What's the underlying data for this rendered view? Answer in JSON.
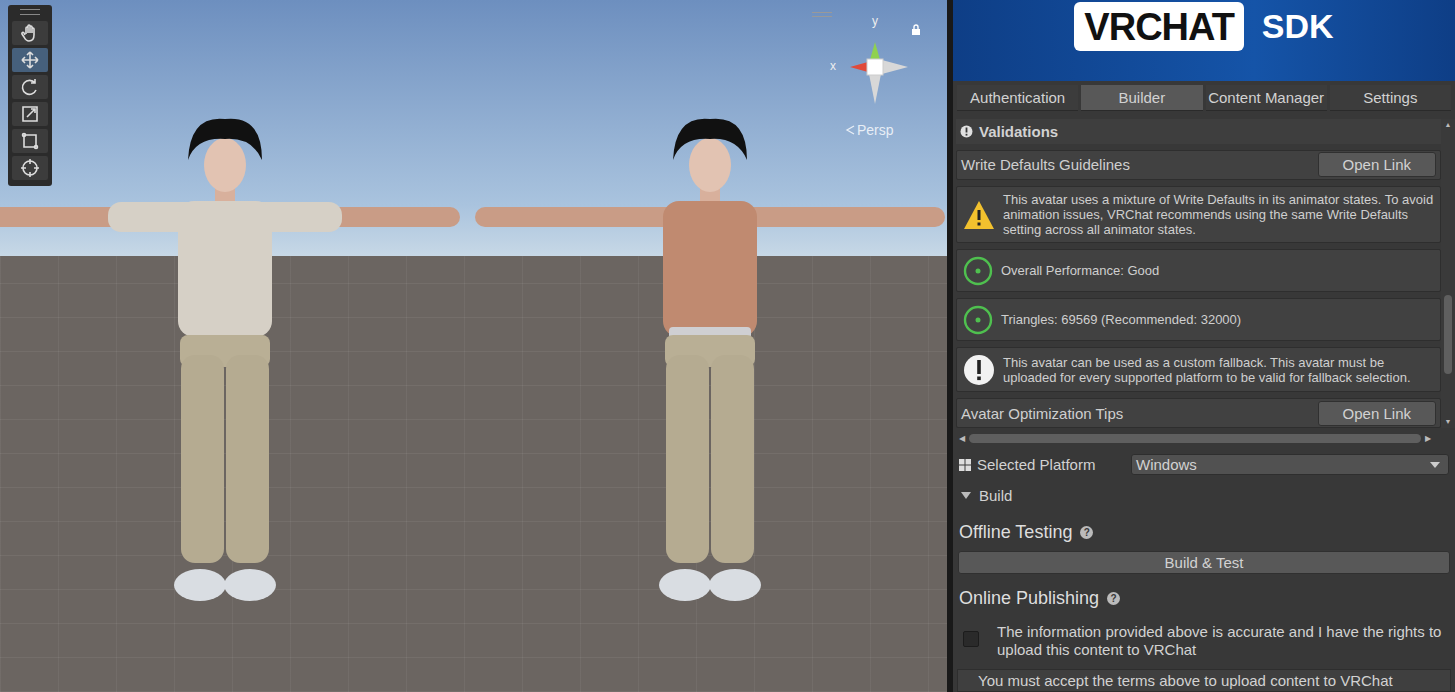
{
  "scene": {
    "tools": [
      {
        "selected": false
      },
      {
        "selected": true
      },
      {
        "selected": false
      },
      {
        "selected": false
      },
      {
        "selected": false
      },
      {
        "selected": false
      }
    ],
    "gizmo": {
      "x": "x",
      "y": "y"
    },
    "projection": "Persp",
    "avatars": [
      {
        "kind": "shirt",
        "color": "#d6d0c6"
      },
      {
        "kind": "bare",
        "color": "#c08a70"
      }
    ]
  },
  "sdk": {
    "logo": {
      "main": "VRCHAT",
      "sub": "SDK"
    },
    "tabs": [
      {
        "label": "Authentication",
        "selected": false
      },
      {
        "label": "Builder",
        "selected": true
      },
      {
        "label": "Content Manager",
        "selected": false
      },
      {
        "label": "Settings",
        "selected": false
      }
    ],
    "validations": {
      "title": "Validations",
      "scroll": {
        "level": 0.82
      },
      "items": [
        {
          "kind": "link",
          "text": "Write Defaults Guidelines",
          "button": "Open Link"
        },
        {
          "kind": "warning",
          "text": "This avatar uses a mixture of Write Defaults in its animator states. To avoid animation issues, VRChat recommends using the same Write Defaults setting across all animator states."
        },
        {
          "kind": "ok",
          "text": "Overall Performance: Good"
        },
        {
          "kind": "ok",
          "text": "Triangles: 69569 (Recommended: 32000)"
        },
        {
          "kind": "info",
          "text": "This avatar can be used as a custom fallback. This avatar must be uploaded for every supported platform to be valid for fallback selection."
        },
        {
          "kind": "link",
          "text": "Avatar Optimization Tips",
          "button": "Open Link"
        }
      ]
    },
    "platform": {
      "label": "Selected Platform",
      "value": "Windows"
    },
    "build": {
      "title": "Build",
      "expanded": true,
      "offline": {
        "title": "Offline Testing",
        "help": "?",
        "button": "Build & Test"
      },
      "online": {
        "title": "Online Publishing",
        "help": "?",
        "checkbox": {
          "label": "The information provided above is accurate and I have the rights to upload this content to VRChat",
          "checked": false
        },
        "notice": "You must accept the terms above to upload content to VRChat"
      }
    }
  }
}
